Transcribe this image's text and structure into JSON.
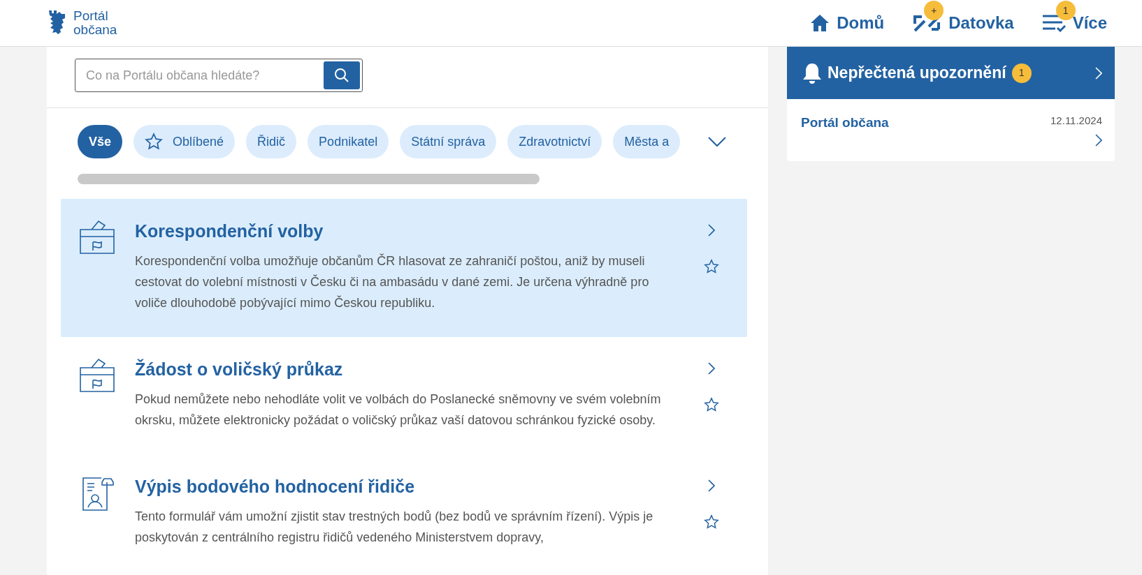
{
  "header": {
    "logo": {
      "line1": "Portál",
      "line2": "občana"
    },
    "nav": [
      {
        "label": "Domů",
        "kind": "home"
      },
      {
        "label": "Datovka",
        "kind": "arrows",
        "badge": "+"
      },
      {
        "label": "Více",
        "kind": "menu",
        "badge": "1"
      }
    ]
  },
  "search": {
    "placeholder": "Co na Portálu občana hledáte?"
  },
  "filters": [
    {
      "label": "Vše",
      "selected": true,
      "kind": "plain"
    },
    {
      "label": "Oblíbené",
      "selected": false,
      "kind": "star"
    },
    {
      "label": "Řidič",
      "selected": false,
      "kind": "plain"
    },
    {
      "label": "Podnikatel",
      "selected": false,
      "kind": "plain"
    },
    {
      "label": "Státní správa",
      "selected": false,
      "kind": "plain"
    },
    {
      "label": "Zdravotnictví",
      "selected": false,
      "kind": "plain"
    },
    {
      "label": "Města a",
      "selected": false,
      "kind": "plain"
    }
  ],
  "services": [
    {
      "title": "Korespondenční volby",
      "description": "Korespondenční volba umožňuje občanům ČR hlasovat ze zahraničí poštou, aniž by museli cestovat do volební místnosti v Česku či na ambasádu v dané zemi. Je určena výhradně pro voliče dlouhodobě pobývající mimo Českou republiku.",
      "kind": "ballot",
      "highlighted": true
    },
    {
      "title": "Žádost o voličský průkaz",
      "description": "Pokud nemůžete nebo nehodláte volit ve volbách do Poslanecké sněmovny ve svém volebním okrsku, můžete elektronicky požádat o voličský průkaz vaší datovou schránkou fyzické osoby.",
      "kind": "ballot",
      "highlighted": false
    },
    {
      "title": "Výpis bodového hodnocení řidiče",
      "description": "Tento formulář vám umožní zjistit stav trestných bodů (bez bodů ve správním řízení). Výpis je poskytován z centrálního registru řidičů vedeného Ministerstvem dopravy,",
      "kind": "license",
      "highlighted": false
    }
  ],
  "notifications": {
    "title": "Nepřečtená upozornění",
    "count": "1",
    "items": [
      {
        "title": "Portál občana",
        "date": "12.11.2024"
      }
    ]
  }
}
